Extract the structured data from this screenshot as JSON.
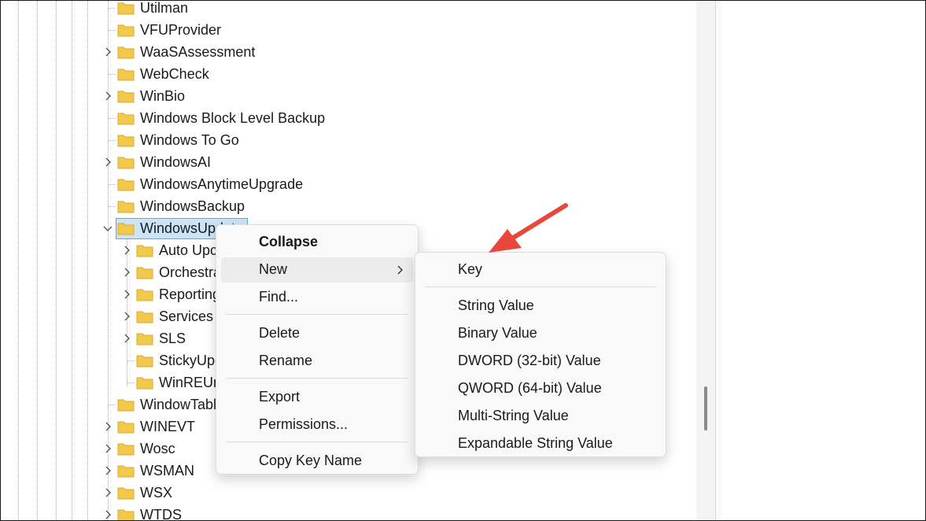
{
  "tree": {
    "items": [
      {
        "label": "Utilman"
      },
      {
        "label": "VFUProvider"
      },
      {
        "label": "WaaSAssessment"
      },
      {
        "label": "WebCheck"
      },
      {
        "label": "WinBio"
      },
      {
        "label": "Windows Block Level Backup"
      },
      {
        "label": "Windows To Go"
      },
      {
        "label": "WindowsAI"
      },
      {
        "label": "WindowsAnytimeUpgrade"
      },
      {
        "label": "WindowsBackup"
      },
      {
        "label": "WindowsUpdate"
      },
      {
        "label": "Auto Upc"
      },
      {
        "label": "Orchestra"
      },
      {
        "label": "Reporting"
      },
      {
        "label": "Services"
      },
      {
        "label": "SLS"
      },
      {
        "label": "StickyUpc"
      },
      {
        "label": "WinREUn"
      },
      {
        "label": "WindowTabl"
      },
      {
        "label": "WINEVT"
      },
      {
        "label": "Wosc"
      },
      {
        "label": "WSMAN"
      },
      {
        "label": "WSX"
      },
      {
        "label": "WTDS"
      }
    ]
  },
  "context_menu": {
    "collapse": "Collapse",
    "new": "New",
    "find": "Find...",
    "delete": "Delete",
    "rename": "Rename",
    "export": "Export",
    "permissions": "Permissions...",
    "copy_key_name": "Copy Key Name"
  },
  "submenu": {
    "key": "Key",
    "string_value": "String Value",
    "binary_value": "Binary Value",
    "dword_value": "DWORD (32-bit) Value",
    "qword_value": "QWORD (64-bit) Value",
    "multi_string_value": "Multi-String Value",
    "expandable_string_value": "Expandable String Value"
  },
  "colors": {
    "folder": "#f2c94c",
    "annotation_arrow": "#e8483b",
    "selection": "#cce4f7"
  },
  "icons": {
    "folder": "folder-icon",
    "expand": "chevron-right-icon",
    "collapse": "chevron-down-icon",
    "submenu": "chevron-right-icon"
  }
}
